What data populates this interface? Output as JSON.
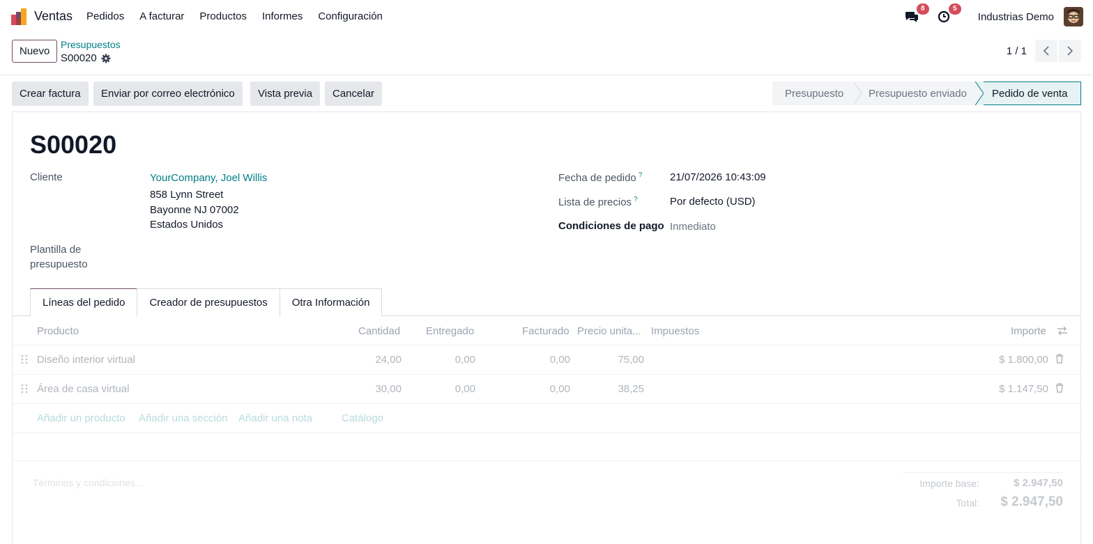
{
  "navbar": {
    "app_name": "Ventas",
    "menu": [
      "Pedidos",
      "A facturar",
      "Productos",
      "Informes",
      "Configuración"
    ],
    "messages_count": "8",
    "activities_count": "5",
    "company": "Industrias Demo"
  },
  "control": {
    "new_label": "Nuevo",
    "breadcrumb": "Presupuestos",
    "record": "S00020",
    "pager": "1 / 1"
  },
  "actions": {
    "create_invoice": "Crear factura",
    "send_email": "Enviar por correo electrónico",
    "preview": "Vista previa",
    "cancel": "Cancelar"
  },
  "status": {
    "steps": [
      "Presupuesto",
      "Presupuesto enviado",
      "Pedido de venta"
    ],
    "active": "Pedido de venta"
  },
  "form": {
    "title": "S00020",
    "customer_label": "Cliente",
    "customer_name": "YourCompany, Joel Willis",
    "address": [
      "858 Lynn Street",
      "Bayonne NJ 07002",
      "Estados Unidos"
    ],
    "template_label_1": "Plantilla de",
    "template_label_2": "presupuesto",
    "order_date_label": "Fecha de pedido",
    "order_date": "21/07/2026 10:43:09",
    "pricelist_label": "Lista de precios",
    "pricelist": "Por defecto (USD)",
    "payment_terms_label": "Condiciones de pago",
    "payment_terms": "Inmediato",
    "help_mark": "?"
  },
  "tabs": [
    "Líneas del pedido",
    "Creador de presupuestos",
    "Otra Información"
  ],
  "table": {
    "headers": {
      "product": "Producto",
      "qty": "Cantidad",
      "delivered": "Entregado",
      "invoiced": "Facturado",
      "unit_price": "Precio unita...",
      "taxes": "Impuestos",
      "amount": "Importe"
    },
    "rows": [
      {
        "product": "Diseño interior virtual",
        "qty": "24,00",
        "delivered": "0,00",
        "invoiced": "0,00",
        "unit_price": "75,00",
        "taxes": "",
        "amount": "$ 1.800,00"
      },
      {
        "product": "Área de casa virtual",
        "qty": "30,00",
        "delivered": "0,00",
        "invoiced": "0,00",
        "unit_price": "38,25",
        "taxes": "",
        "amount": "$ 1.147,50"
      }
    ],
    "add_product": "Añadir un producto",
    "add_section": "Añadir una sección",
    "add_note": "Añadir una nota",
    "catalog": "Catálogo"
  },
  "footer": {
    "terms_placeholder": "Términos y condiciones...",
    "base_label": "Importe base:",
    "base_value": "$ 2.947,50",
    "total_label": "Total:",
    "total_value": "$ 2.947,50"
  },
  "colors": {
    "brand": "#714b67",
    "link": "#017e84",
    "badge": "#d44c59"
  }
}
